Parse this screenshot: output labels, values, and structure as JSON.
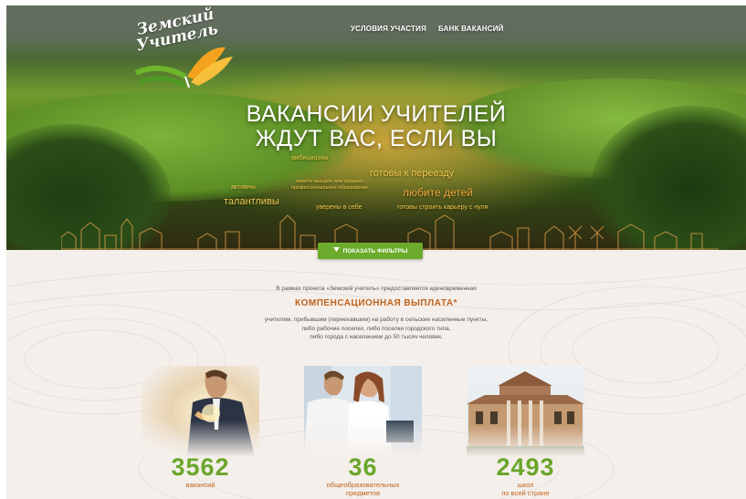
{
  "logo": {
    "line1": "Земский",
    "line2": "Учитель"
  },
  "nav": {
    "items": [
      "УСЛОВИЯ УЧАСТИЯ",
      "БАНК ВАКАНСИЙ"
    ]
  },
  "hero": {
    "headline_line1": "ВАКАНСИИ УЧИТЕЛЕЙ",
    "headline_line2": "ЖДУТ ВАС, ЕСЛИ ВЫ",
    "tags": {
      "ambitious": "амбициозны",
      "ready_to_move": "готовы к переезду",
      "higher_education_line1": "имеете высшее или среднее",
      "higher_education_line2": "профессиональное образование",
      "active": "активны",
      "love_children": "любите детей",
      "talented": "талантливы",
      "confident": "уверены в себе",
      "career_from_zero": "готовы строить карьеру с нуля"
    }
  },
  "filter_button": {
    "label": "ПОКАЗАТЬ ФИЛЬТРЫ",
    "icon": "triangle-down-icon"
  },
  "info": {
    "intro": "В рамках проекта «Земский учитель» предоставляется единовременная",
    "compensation": "КОМПЕНСАЦИОННАЯ ВЫПЛАТА",
    "compensation_mark": "*",
    "desc_line1": "учителям, прибывшим (переехавшим) на работу в сельские населенные пункты,",
    "desc_line2": "либо рабочие поселки, либо поселки городского типа,",
    "desc_line3": "либо города с населением до 50 тысяч человек."
  },
  "stats": [
    {
      "value": "3562",
      "label_line1": "вакансий",
      "label_line2": ""
    },
    {
      "value": "36",
      "label_line1": "общеобразовательных",
      "label_line2": "предметов"
    },
    {
      "value": "2493",
      "label_line1": "школ",
      "label_line2": "по всей стране"
    }
  ],
  "colors": {
    "accent_green": "#6cab2b",
    "accent_orange": "#c0641d",
    "tag_yellow": "#f1c84b"
  }
}
